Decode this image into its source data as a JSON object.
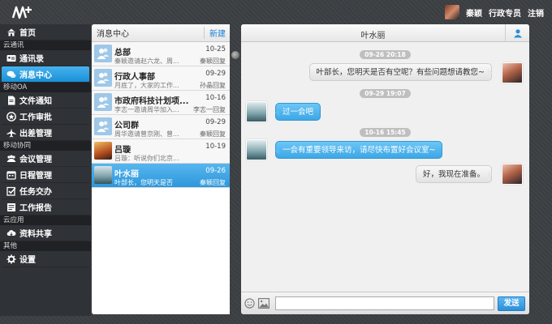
{
  "header": {
    "user_name": "秦颖",
    "role_link": "行政专员",
    "logout": "注销"
  },
  "sidebar": {
    "groups": [
      {
        "label": ""
      },
      {
        "label": "云通讯"
      },
      {
        "label": "移动OA"
      },
      {
        "label": "移动协同"
      },
      {
        "label": "云应用"
      },
      {
        "label": "其他"
      }
    ],
    "items": [
      {
        "label": "首页",
        "icon": "home-icon"
      },
      {
        "label": "通讯录",
        "icon": "contacts-icon"
      },
      {
        "label": "消息中心",
        "icon": "chat-icon",
        "active": true
      },
      {
        "label": "文件通知",
        "icon": "document-icon"
      },
      {
        "label": "工作审批",
        "icon": "approval-icon"
      },
      {
        "label": "出差管理",
        "icon": "airplane-icon"
      },
      {
        "label": "会议管理",
        "icon": "meeting-icon"
      },
      {
        "label": "日程管理",
        "icon": "calendar-icon"
      },
      {
        "label": "任务交办",
        "icon": "task-icon"
      },
      {
        "label": "工作报告",
        "icon": "report-icon"
      },
      {
        "label": "资料共享",
        "icon": "cloud-share-icon"
      },
      {
        "label": "设置",
        "icon": "gear-icon"
      }
    ]
  },
  "message_list": {
    "title": "消息中心",
    "new_button": "新建",
    "conversations": [
      {
        "name": "总部",
        "date": "10-25",
        "preview": "秦颖邀请赵六龙、周...",
        "sender": "秦颖回复"
      },
      {
        "name": "行政人事部",
        "date": "09-29",
        "preview": "月底了，大家的工作...",
        "sender": "孙晶回复"
      },
      {
        "name": "市政府科技计划项...",
        "date": "10-16",
        "preview": "李志一邀请周华加入...",
        "sender": "李志一回复"
      },
      {
        "name": "公司群",
        "date": "09-29",
        "preview": "周华邀请曾京刚、曾...",
        "sender": "秦颖回复"
      },
      {
        "name": "吕璇",
        "date": "10-19",
        "preview": "吕璇：听说你们北京...",
        "sender": ""
      },
      {
        "name": "叶水丽",
        "date": "09-26",
        "preview": "叶部长，您明天是否",
        "sender": "秦颖回复",
        "active": true
      }
    ]
  },
  "chat": {
    "title": "叶水丽",
    "messages": [
      {
        "stamp": "09-26 20:18",
        "text": "叶部长，您明天是否有空呢？有些问题想请教您~",
        "dir": "out"
      },
      {
        "stamp": "09-29 19:07",
        "text": "过一会吧",
        "dir": "in"
      },
      {
        "stamp": "10-16 15:45",
        "text": "一会有重要领导来访，请尽快布置好会议室~",
        "dir": "in"
      },
      {
        "stamp": "",
        "text": "好，我现在准备。",
        "dir": "out"
      }
    ],
    "input_value": "",
    "send_label": "发送"
  }
}
